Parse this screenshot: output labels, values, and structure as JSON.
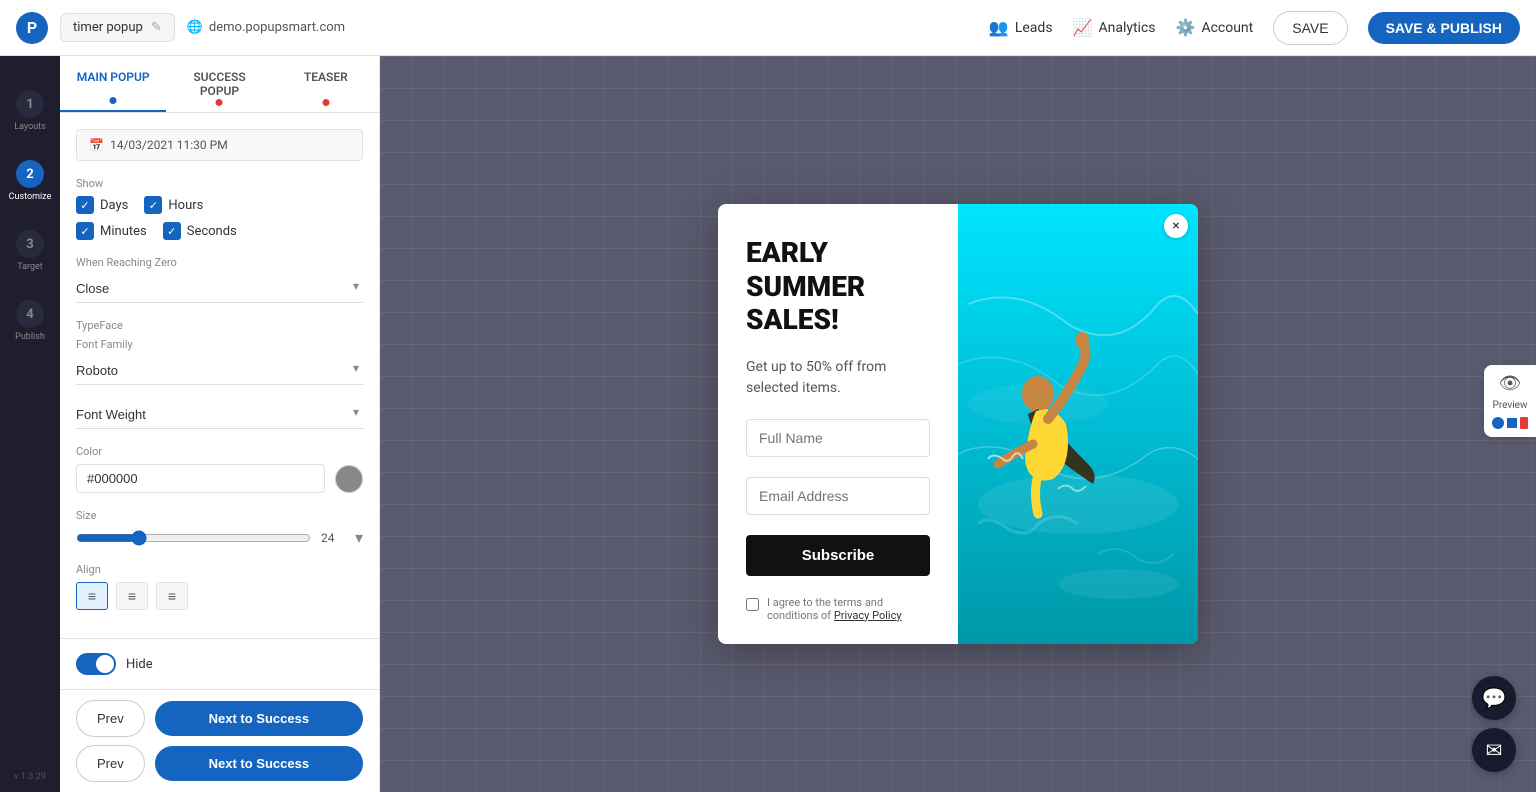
{
  "topbar": {
    "logo_letter": "P",
    "popup_name": "timer popup",
    "url": "demo.popupsmart.com",
    "leads_label": "Leads",
    "analytics_label": "Analytics",
    "account_label": "Account",
    "save_label": "SAVE",
    "save_publish_label": "SAVE & PUBLISH"
  },
  "sidebar": {
    "items": [
      {
        "number": "1",
        "label": "Layouts"
      },
      {
        "number": "2",
        "label": "Customize"
      },
      {
        "number": "3",
        "label": "Target"
      },
      {
        "number": "4",
        "label": "Publish"
      }
    ],
    "version": "v 1.3.29"
  },
  "panel": {
    "tabs": [
      {
        "label": "MAIN POPUP",
        "active": true
      },
      {
        "label": "SUCCESS POPUP",
        "active": false
      },
      {
        "label": "TEASER",
        "active": false
      }
    ],
    "datetime": "14/03/2021 11:30 PM",
    "show_section_label": "Show",
    "show_items": [
      "Days",
      "Hours",
      "Minutes",
      "Seconds"
    ],
    "when_reaching_zero_label": "When Reaching Zero",
    "when_reaching_zero_value": "Close",
    "typeface_label": "TypeFace",
    "font_family_label": "Font Family",
    "font_family_value": "Roboto",
    "font_weight_label": "Font Weight",
    "color_label": "Color",
    "color_value": "#000000",
    "size_label": "Size",
    "size_value": "24",
    "align_label": "Align",
    "hide_label": "Hide",
    "prev_label": "Prev",
    "next_label": "Next to Success"
  },
  "popup": {
    "headline": "EARLY SUMMER SALES!",
    "subtext": "Get up to 50% off from selected items.",
    "full_name_placeholder": "Full Name",
    "email_placeholder": "Email Address",
    "subscribe_label": "Subscribe",
    "privacy_text": "I agree to the terms and conditions of",
    "privacy_link": "Privacy Policy",
    "close_icon": "×"
  },
  "preview": {
    "label": "Preview"
  }
}
